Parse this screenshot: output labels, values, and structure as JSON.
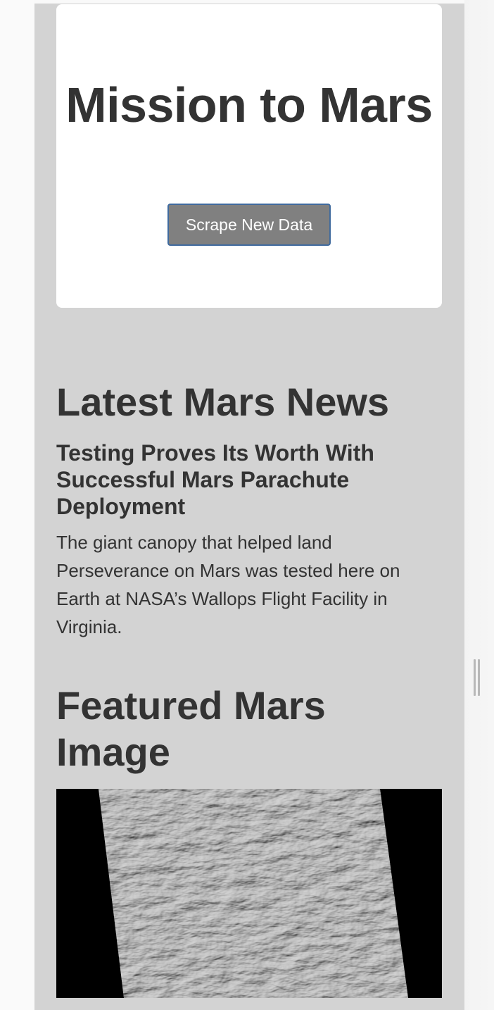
{
  "header": {
    "title": "Mission to Mars",
    "scrape_button_label": "Scrape New Data"
  },
  "news": {
    "section_title": "Latest Mars News",
    "headline": "Testing Proves Its Worth With Successful Mars Parachute Deployment",
    "teaser": "The giant canopy that helped land Perseverance on Mars was tested here on Earth at NASA’s Wallops Flight Facility in Virginia."
  },
  "featured": {
    "section_title": "Featured Mars Image",
    "image_subject": "grayscale-mars-dune-field-strip"
  },
  "colors": {
    "page_background": "#d3d3d3",
    "card_background": "#ffffff",
    "button_background": "#808080",
    "button_border": "#3f6a9e",
    "text": "#333333"
  }
}
